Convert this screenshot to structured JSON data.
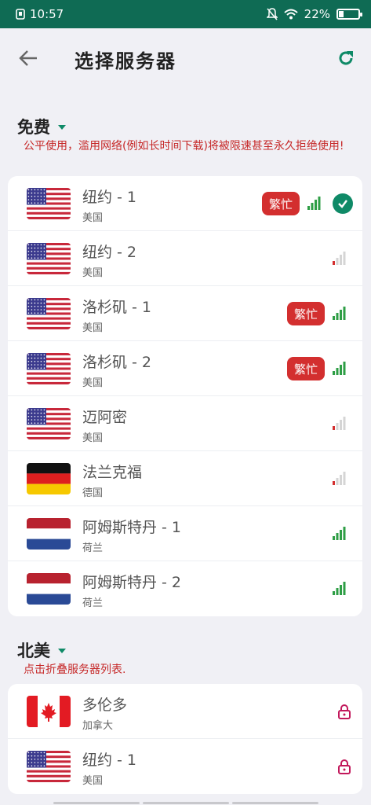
{
  "status_bar": {
    "time": "10:57",
    "battery": "22%",
    "battery_level": 0.22
  },
  "header": {
    "title": "选择服务器"
  },
  "sections": [
    {
      "title": "免费",
      "note": "公平使用，滥用网络(例如长时间下载)将被限速甚至永久拒绝使用!",
      "servers": [
        {
          "name": "纽约 - 1",
          "country": "美国",
          "flag": "us",
          "busy": "繁忙",
          "signal": "good",
          "selected": true
        },
        {
          "name": "纽约 - 2",
          "country": "美国",
          "flag": "us",
          "busy": "",
          "signal": "weak",
          "selected": false
        },
        {
          "name": "洛杉矶 - 1",
          "country": "美国",
          "flag": "us",
          "busy": "繁忙",
          "signal": "good",
          "selected": false
        },
        {
          "name": "洛杉矶 - 2",
          "country": "美国",
          "flag": "us",
          "busy": "繁忙",
          "signal": "good",
          "selected": false
        },
        {
          "name": "迈阿密",
          "country": "美国",
          "flag": "us",
          "busy": "",
          "signal": "weak",
          "selected": false
        },
        {
          "name": "法兰克福",
          "country": "德国",
          "flag": "de",
          "busy": "",
          "signal": "weak",
          "selected": false
        },
        {
          "name": "阿姆斯特丹 - 1",
          "country": "荷兰",
          "flag": "nl",
          "busy": "",
          "signal": "good",
          "selected": false
        },
        {
          "name": "阿姆斯特丹 - 2",
          "country": "荷兰",
          "flag": "nl",
          "busy": "",
          "signal": "good",
          "selected": false
        }
      ]
    },
    {
      "title": "北美",
      "note": "点击折叠服务器列表.",
      "servers": [
        {
          "name": "多伦多",
          "country": "加拿大",
          "flag": "ca",
          "locked": true
        },
        {
          "name": "纽约 - 1",
          "country": "美国",
          "flag": "us",
          "locked": true
        }
      ]
    }
  ],
  "colors": {
    "accent": "#0f8a67",
    "busy": "#d32f2f",
    "note": "#c62828",
    "signal_good": "#2e9e45",
    "signal_weak": "#d32f2f",
    "lock": "#c2185b"
  }
}
